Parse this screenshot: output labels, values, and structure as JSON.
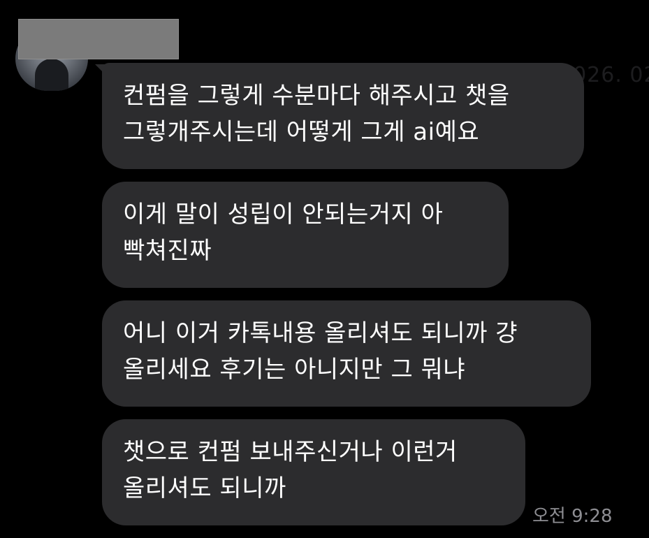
{
  "watermark": {
    "date": "2026. 02"
  },
  "messages": [
    {
      "lines": [
        "컨펌을 그렇게 수분마다 해주시고 챗을",
        "그렇개주시는데 어떻게 그게 ai예요"
      ]
    },
    {
      "lines": [
        "이게 말이 성립이 안되는거지 아",
        "빡쳐진짜"
      ]
    },
    {
      "lines": [
        "어니 이거 카톡내용 올리셔도 되니까 걍",
        "올리세요 후기는 아니지만 그 뭐냐"
      ]
    },
    {
      "lines": [
        "챗으로 컨펌 보내주신거나 이런거",
        "올리셔도 되니까"
      ]
    }
  ],
  "timestamp": "오전 9:28",
  "icons": {
    "avatar": "profile-avatar",
    "redaction": "name-redacted-block"
  },
  "colors": {
    "background": "#000000",
    "bubble": "#2c2c2e",
    "text": "#ffffff",
    "timestamp": "#8e8e93"
  }
}
